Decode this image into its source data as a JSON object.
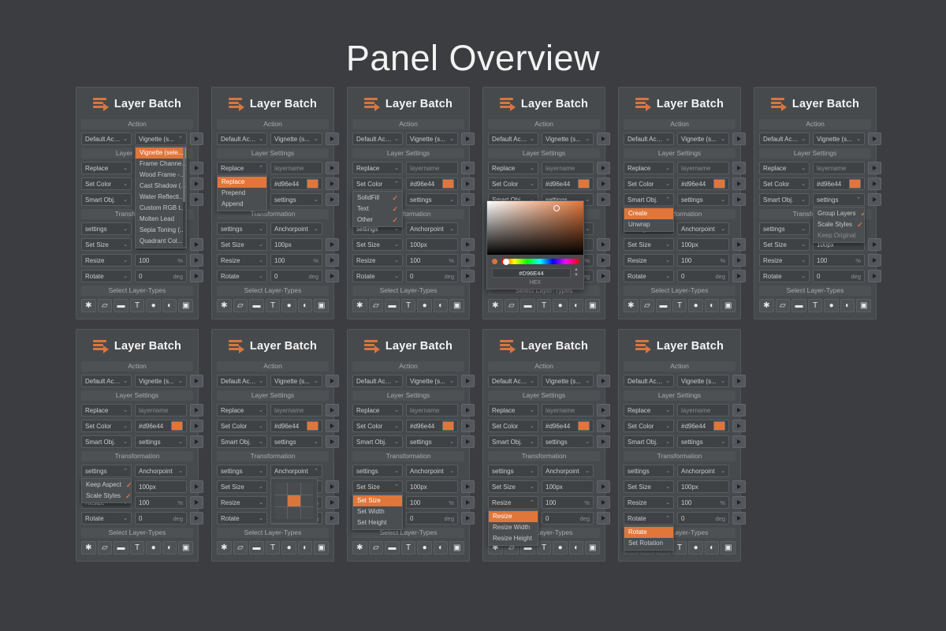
{
  "page": {
    "title": "Panel Overview",
    "background": "#3b3d40",
    "accent": "#d9763f"
  },
  "panel": {
    "title": "Layer Batch",
    "sections": {
      "action": "Action",
      "layer_settings": "Layer Settings",
      "transformation": "Transformation",
      "select_layer_types": "Select Layer-Types"
    },
    "action_row": {
      "left": "Default Act...",
      "right": "Vignette (s..."
    },
    "layer_rows": [
      {
        "left": "Replace",
        "right_placeholder": "layername"
      },
      {
        "left": "Set Color",
        "right_value": "#d96e44",
        "swatch": "#e0763a"
      },
      {
        "left": "Smart Obj.",
        "right": "settings"
      }
    ],
    "transform_rows": [
      {
        "left": "settings",
        "right": "Anchorpoint"
      },
      {
        "left": "Set Size",
        "value": "100px",
        "unit": ""
      },
      {
        "left": "Resize",
        "value": "100",
        "unit": "%"
      },
      {
        "left": "Rotate",
        "value": "0",
        "unit": "deg"
      }
    ],
    "footer_icons": [
      {
        "name": "asterisk-icon",
        "glyph": "✱"
      },
      {
        "name": "shape-layer-icon",
        "glyph": "▱"
      },
      {
        "name": "folder-icon",
        "glyph": "▬"
      },
      {
        "name": "text-layer-icon",
        "glyph": "T"
      },
      {
        "name": "pixel-layer-icon",
        "glyph": "●"
      },
      {
        "name": "adjustment-layer-icon",
        "glyph": "◐"
      },
      {
        "name": "smart-object-icon",
        "glyph": "▣"
      }
    ]
  },
  "dropdowns": {
    "action_list": {
      "title": "Vignette (s...",
      "items": [
        {
          "label": "Vignette (sele...",
          "selected": true
        },
        {
          "label": "Frame Channe..."
        },
        {
          "label": "Wood Frame -..."
        },
        {
          "label": "Cast Shadow (..."
        },
        {
          "label": "Water Reflecti..."
        },
        {
          "label": "Custom RGB t..."
        },
        {
          "label": "Molten Lead"
        },
        {
          "label": "Sepia Toning (..."
        },
        {
          "label": "Quadrant Col..."
        }
      ]
    },
    "rename_mode": {
      "items": [
        {
          "label": "Replace",
          "selected": true
        },
        {
          "label": "Prepend"
        },
        {
          "label": "Append"
        }
      ]
    },
    "set_color_targets": {
      "items": [
        {
          "label": "SolidFill",
          "check": "✓"
        },
        {
          "label": "Text",
          "check": "✓"
        },
        {
          "label": "Other",
          "check": "✓"
        }
      ]
    },
    "smart_object_mode": {
      "items": [
        {
          "label": "Create",
          "selected": true
        },
        {
          "label": "Unwrap"
        }
      ]
    },
    "smart_object_settings": {
      "items": [
        {
          "label": "Group Layers",
          "check": "✓"
        },
        {
          "label": "Scale Styles",
          "check": "✓"
        },
        {
          "label": "Keep Original",
          "dim": true
        }
      ]
    },
    "transform_settings": {
      "items": [
        {
          "label": "Keep Aspect",
          "check": "✓"
        },
        {
          "label": "Scale Styles",
          "check": "✓"
        }
      ]
    },
    "size_mode": {
      "items": [
        {
          "label": "Set Size",
          "selected": true
        },
        {
          "label": "Set Width"
        },
        {
          "label": "Set Height"
        }
      ]
    },
    "resize_mode": {
      "items": [
        {
          "label": "Resize",
          "selected": true
        },
        {
          "label": "Resize Width"
        },
        {
          "label": "Resize Height"
        }
      ]
    },
    "rotate_mode": {
      "items": [
        {
          "label": "Rotate",
          "selected": true
        },
        {
          "label": "Set Rotation"
        }
      ]
    }
  },
  "color_picker": {
    "hex": "#D96E44",
    "label": "HEX",
    "swatch": "#d9763f"
  },
  "anchorpoint": {
    "selected_index": 4,
    "cells": 9
  }
}
